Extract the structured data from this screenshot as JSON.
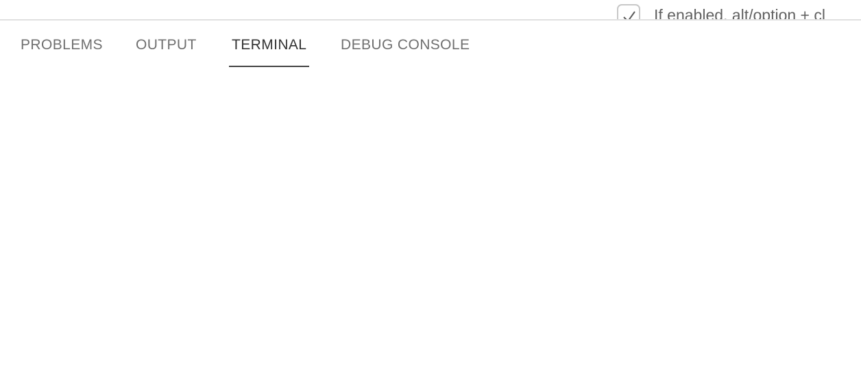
{
  "settings_row": {
    "checkbox_checked": true,
    "description": "If enabled, alt/option + cl"
  },
  "panel": {
    "tabs": [
      {
        "label": "PROBLEMS",
        "active": false
      },
      {
        "label": "OUTPUT",
        "active": false
      },
      {
        "label": "TERMINAL",
        "active": true
      },
      {
        "label": "DEBUG CONSOLE",
        "active": false
      }
    ]
  },
  "colors": {
    "active_tab_text": "#333333",
    "inactive_tab_text": "#6f6f6f",
    "active_underline": "#424242",
    "border": "#e0e0e0"
  }
}
